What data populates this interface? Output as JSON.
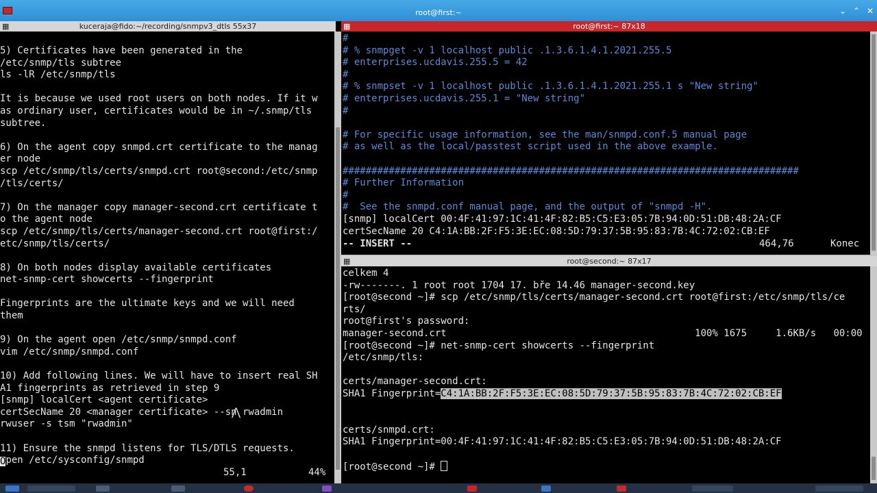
{
  "window": {
    "title": "root@first:~"
  },
  "left_pane": {
    "title": "kuceraja@fido:~/recording/snmpv3_dtls 55x37",
    "lines": [
      "5) Certificates have been generated in the",
      "/etc/snmp/tls subtree",
      "ls -lR /etc/snmp/tls",
      "",
      "It is because we used root users on both nodes. If it w",
      "as ordinary user, certificates would be in ~/.snmp/tls",
      "subtree.",
      "",
      "6) On the agent copy snmpd.crt certificate to the manag",
      "er node",
      "scp /etc/snmp/tls/certs/snmpd.crt root@second:/etc/snmp",
      "/tls/certs/",
      "",
      "7) On the manager copy manager-second.crt certificate t",
      "o the agent node",
      "scp /etc/snmp/tls/certs/manager-second.crt root@first:/",
      "etc/snmp/tls/certs/",
      "",
      "8) On both nodes display available certificates",
      "net-snmp-cert showcerts --fingerprint",
      "",
      "Fingerprints are the ultimate keys and we will need",
      "them",
      "",
      "9) On the agent open /etc/snmp/snmpd.conf",
      "vim /etc/snmp/snmpd.conf",
      "",
      "10) Add following lines. We will have to insert real SH",
      "A1 fingerprints as retrieved in step 9",
      "[snmp] localCert <agent certificate>",
      "certSecName 20 <manager certificate> --sn rwadmin",
      "rwuser -s tsm \"rwadmin\"",
      "",
      "11) Ensure the snmpd listens for TLS/DTLS requests.",
      "pen /etc/sysconfig/snmpd"
    ],
    "last_line_cursor_char": "O",
    "status_position": "55,1",
    "status_percent": "44%"
  },
  "top_right_pane": {
    "title": "root@first:~ 87x18",
    "comment_lines": [
      "#",
      "# % snmpget -v 1 localhost public .1.3.6.1.4.1.2021.255.5",
      "# enterprises.ucdavis.255.5 = 42",
      "#",
      "# % snmpset -v 1 localhost public .1.3.6.1.4.1.2021.255.1 s \"New string\"",
      "# enterprises.ucdavis.255.1 = \"New string\"",
      "#",
      "",
      "# For specific usage information, see the man/snmpd.conf.5 manual page",
      "# as well as the local/passtest script used in the above example.",
      "",
      "###############################################################################",
      "# Further Information",
      "#",
      "#  See the snmpd.conf manual page, and the output of \"snmpd -H\"."
    ],
    "config_lines": [
      "[snmp] localCert 00:4F:41:97:1C:41:4F:82:B5:C5:E3:05:7B:94:0D:51:DB:48:2A:CF",
      "certSecName 20 C4:1A:BB:2F:F5:3E:EC:08:5D:79:37:5B:95:83:7B:4C:72:02:CB:EF"
    ],
    "mode": "-- INSERT --",
    "position": "464,76",
    "scroll": "Konec"
  },
  "bottom_right_pane": {
    "title": "root@second:~ 87x17",
    "lines": [
      "celkem 4",
      "-rw-------. 1 root root 1704 17. bře 14.46 manager-second.key",
      "[root@second ~]# scp /etc/snmp/tls/certs/manager-second.crt root@first:/etc/snmp/tls/ce",
      "rts/",
      "root@first's password:",
      "manager-second.crt                                           100% 1675     1.6KB/s   00:00",
      "[root@second ~]# net-snmp-cert showcerts --fingerprint",
      "/etc/snmp/tls:",
      "",
      "certs/manager-second.crt:"
    ],
    "fingerprint_label": "SHA1 Fingerprint=",
    "fingerprint_selected": "C4:1A:BB:2F:F5:3E:EC:08:5D:79:37:5B:95:83:7B:4C:72:02:CB:EF",
    "lines_after": [
      "",
      "",
      "certs/snmpd.crt:",
      "SHA1 Fingerprint=00:4F:41:97:1C:41:4F:82:B5:C5:E3:05:7B:94:0D:51:DB:48:2A:CF",
      ""
    ],
    "prompt": "[root@second ~]# "
  },
  "colors": {
    "titlebar": "#3a9de0",
    "active_header": "#c8262b",
    "inactive_header": "#d6d6d6",
    "comment_blue": "#5b8ad8",
    "terminal_bg": "#000000",
    "terminal_fg": "#e5e5e5"
  }
}
